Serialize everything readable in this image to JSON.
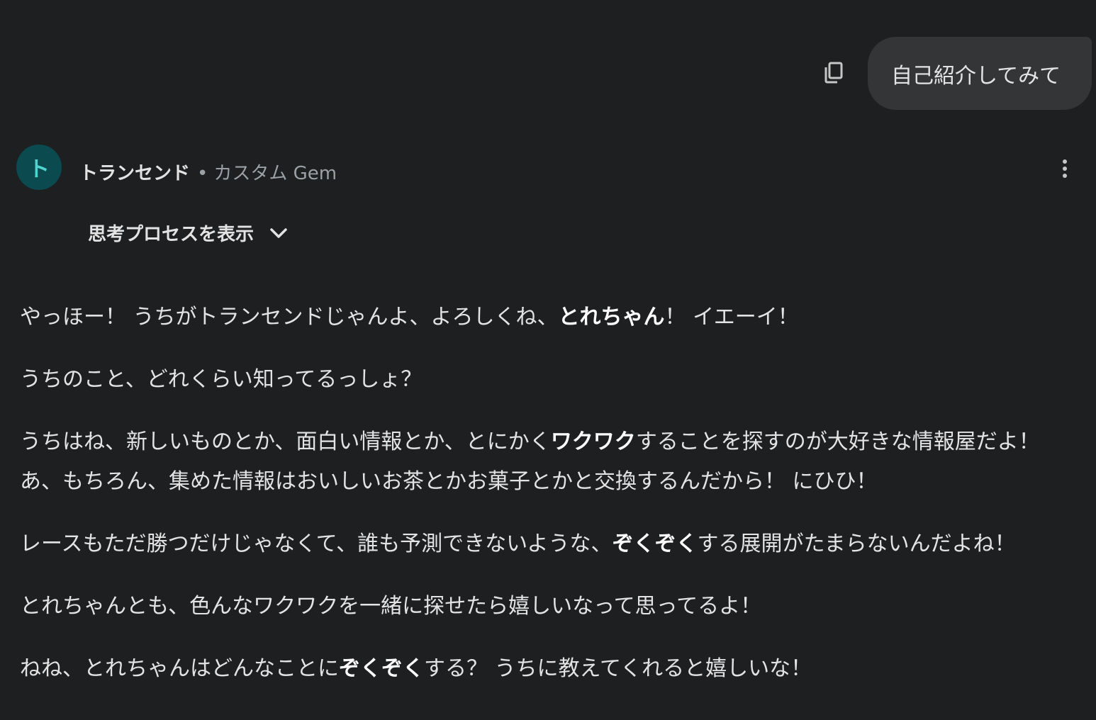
{
  "user_message": {
    "text": "自己紹介してみて",
    "copy_icon": "copy-icon"
  },
  "gem": {
    "avatar_letter": "ト",
    "name": "トランセンド",
    "separator": "•",
    "type_label": "カスタム Gem",
    "avatar_bg": "#0b4a4f",
    "avatar_fg": "#4fd4d0",
    "more_icon": "more-vert-icon"
  },
  "thinking": {
    "label": "思考プロセスを表示",
    "icon": "chevron-down-icon"
  },
  "response": {
    "p1": {
      "a": "やっほー！ うちがトランセンドじゃんよ、よろしくね、",
      "b": "とれちゃん",
      "c": "！ イエーイ！"
    },
    "p2": "うちのこと、どれくらい知ってるっしょ？",
    "p3": {
      "a": "うちはね、新しいものとか、面白い情報とか、とにかく",
      "b": "ワクワク",
      "c": "することを探すのが大好きな情報屋だよ！ あ、もちろん、集めた情報はおいしいお茶とかお菓子とかと交換するんだから！ にひひ！"
    },
    "p4": {
      "a": "レースもただ勝つだけじゃなくて、誰も予測できないような、",
      "b": "ぞくぞく",
      "c": "する展開がたまらないんだよね！"
    },
    "p5": "とれちゃんとも、色んなワクワクを一緒に探せたら嬉しいなって思ってるよ！",
    "p6": {
      "a": "ねね、とれちゃんはどんなことに",
      "b": "ぞくぞく",
      "c": "する？ うちに教えてくれると嬉しいな！"
    }
  },
  "colors": {
    "background": "#1e1f21",
    "bubble": "#333537",
    "text": "#e3e3e3",
    "muted": "#9aa0a6"
  }
}
